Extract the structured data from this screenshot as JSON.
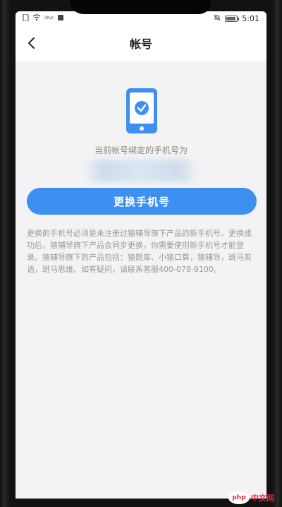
{
  "status_bar": {
    "net_speed": "0K/s",
    "time": "5:01",
    "icons": [
      "sim-icon",
      "wifi-icon",
      "notification-icon",
      "mute-icon",
      "battery-icon"
    ]
  },
  "nav": {
    "back_icon": "chevron-left-icon",
    "title": "帐号"
  },
  "account": {
    "illustration_icon": "phone-check-icon",
    "bound_label": "当前帐号绑定的手机号为",
    "phone_number": "•••••••••••",
    "change_button": "更换手机号",
    "notice": "更换的手机号必须是未注册过猿辅导旗下产品的新手机号。更换成功后，猿辅导旗下产品会同步更换，你需要使用新手机号才能登录。猿辅导旗下的产品包括：猿题库、小猿口算，猿辅导，斑马英语，斑马思维。如有疑问，请联系客服400-078-9100。"
  },
  "watermark": {
    "brand": "php",
    "suffix": "中文网"
  },
  "colors": {
    "accent": "#3d8ff0",
    "background": "#f3f3f5",
    "muted_text": "#999999"
  }
}
